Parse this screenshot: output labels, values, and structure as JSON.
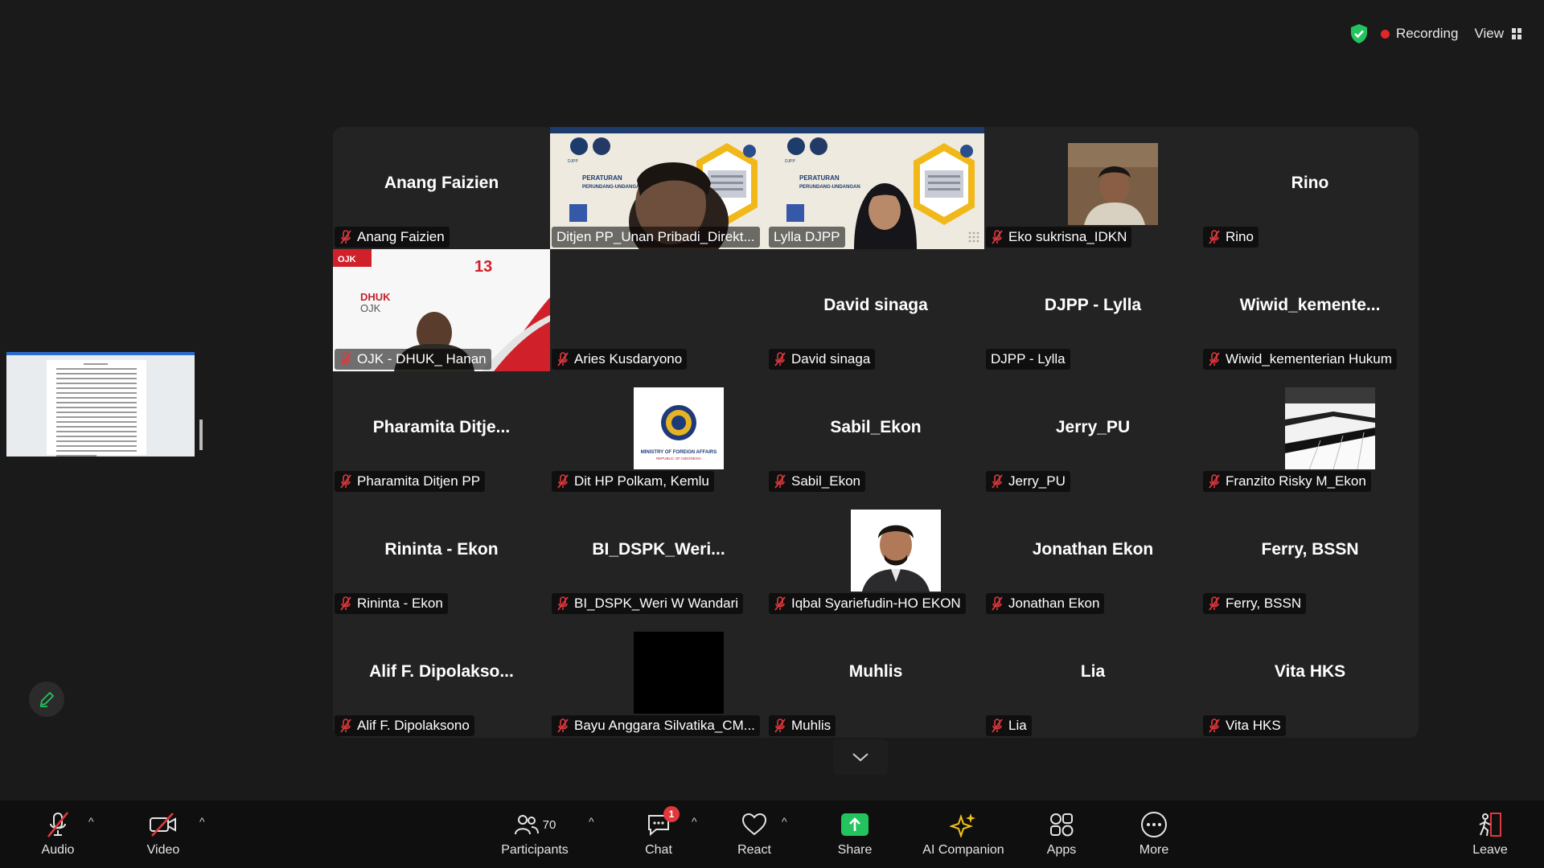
{
  "header": {
    "recording_label": "Recording",
    "view_label": "View"
  },
  "colors": {
    "active_speaker_border": "#23d18b",
    "recording_dot": "#e02828",
    "share_green": "#23c45e",
    "muted_red": "#e0383e"
  },
  "tiles": [
    {
      "big": "Anang Faizien",
      "label": "Anang Faizien",
      "muted": true
    },
    {
      "big": "",
      "label": "Ditjen PP_Unan Pribadi_Direkt...",
      "muted": false,
      "video": true
    },
    {
      "big": "",
      "label": "Lylla DJPP",
      "muted": false,
      "video": true,
      "active": true
    },
    {
      "big": "",
      "label": "Eko sukrisna_IDKN",
      "muted": true,
      "photo": true
    },
    {
      "big": "Rino",
      "label": "Rino",
      "muted": true
    },
    {
      "big": "",
      "label": "OJK - DHUK_ Hanan",
      "muted": true,
      "video": true
    },
    {
      "big": "",
      "label": "Aries Kusdaryono",
      "muted": true
    },
    {
      "big": "David sinaga",
      "label": "David sinaga",
      "muted": true
    },
    {
      "big": "DJPP - Lylla",
      "label": "DJPP - Lylla",
      "muted": false
    },
    {
      "big": "Wiwid_kemente...",
      "label": "Wiwid_kementerian Hukum",
      "muted": true
    },
    {
      "big": "Pharamita  Ditje...",
      "label": "Pharamita Ditjen PP",
      "muted": true
    },
    {
      "big": "",
      "label": "Dit HP Polkam, Kemlu",
      "muted": true,
      "photo": true
    },
    {
      "big": "Sabil_Ekon",
      "label": "Sabil_Ekon",
      "muted": true
    },
    {
      "big": "Jerry_PU",
      "label": "Jerry_PU",
      "muted": true
    },
    {
      "big": "",
      "label": "Franzito Risky M_Ekon",
      "muted": true,
      "photo": true
    },
    {
      "big": "Rininta - Ekon",
      "label": "Rininta - Ekon",
      "muted": true
    },
    {
      "big": "BI_DSPK_Weri...",
      "label": "BI_DSPK_Weri W Wandari",
      "muted": true
    },
    {
      "big": "",
      "label": "Iqbal Syariefudin-HO EKON",
      "muted": true,
      "photo": true
    },
    {
      "big": "Jonathan Ekon",
      "label": "Jonathan Ekon",
      "muted": true
    },
    {
      "big": "Ferry,  BSSN",
      "label": "Ferry,  BSSN",
      "muted": true
    },
    {
      "big": "Alif  F.  Dipolakso...",
      "label": "Alif F. Dipolaksono",
      "muted": true
    },
    {
      "big": "",
      "label": "Bayu Anggara Silvatika_CM...",
      "muted": true,
      "photo": true
    },
    {
      "big": "Muhlis",
      "label": "Muhlis",
      "muted": true
    },
    {
      "big": "Lia",
      "label": "Lia",
      "muted": true
    },
    {
      "big": "Vita HKS",
      "label": "Vita HKS",
      "muted": true
    }
  ],
  "slide_text": {
    "djpp": "DJPP",
    "peraturan": "PERATURAN",
    "perundang": "PERUNDANG-UNDANGAN"
  },
  "ojk_slide": {
    "ojk": "OJK",
    "dhuk": "DHUK",
    "dhuk_ojk": "OJK",
    "number": "13"
  },
  "kemlu_logo_text": "MINISTRY OF FOREIGN AFFAIRS",
  "kemlu_logo_sub": "REPUBLIC OF INDONESIA",
  "toolbar": {
    "audio_label": "Audio",
    "video_label": "Video",
    "participants_label": "Participants",
    "participants_count": "70",
    "chat_label": "Chat",
    "chat_badge": "1",
    "react_label": "React",
    "share_label": "Share",
    "ai_label": "AI Companion",
    "apps_label": "Apps",
    "more_label": "More",
    "leave_label": "Leave"
  }
}
